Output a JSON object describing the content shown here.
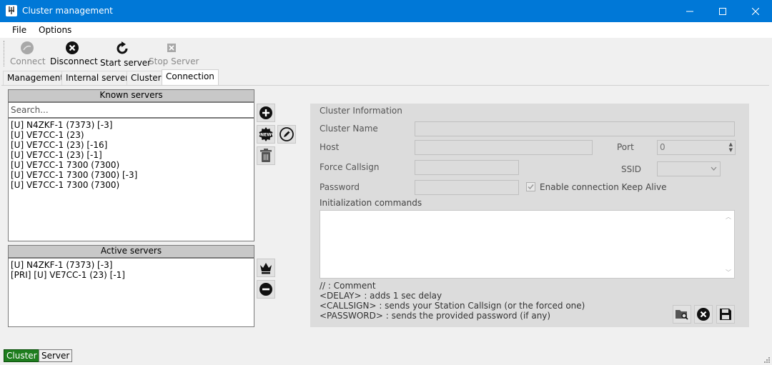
{
  "window": {
    "title": "Cluster management"
  },
  "menu": {
    "file": "File",
    "options": "Options"
  },
  "toolbar": {
    "connect": "Connect",
    "disconnect": "Disconnect",
    "start_server": "Start server",
    "stop_server": "Stop Server"
  },
  "tabs": {
    "management": "Management",
    "internal_server": "Internal server",
    "cluster": "Cluster",
    "connection": "Connection"
  },
  "known_servers": {
    "header": "Known servers",
    "search_placeholder": "Search...",
    "items": [
      "[U] N4ZKF-1 (7373) [-3]",
      "[U] VE7CC-1 (23)",
      "[U] VE7CC-1 (23) [-16]",
      "[U] VE7CC-1 (23) [-1]",
      "[U] VE7CC-1 7300 (7300)",
      "[U] VE7CC-1 7300 (7300) [-3]",
      "[U] VE7CC-1 7300 (7300)"
    ]
  },
  "active_servers": {
    "header": "Active servers",
    "items": [
      "[U] N4ZKF-1 (7373) [-3]",
      "[PRI] [U] VE7CC-1 (23) [-1]"
    ]
  },
  "cluster_info": {
    "group_title": "Cluster Information",
    "name_label": "Cluster Name",
    "host_label": "Host",
    "port_label": "Port",
    "port_value": "0",
    "force_callsign_label": "Force Callsign",
    "ssid_label": "SSID",
    "password_label": "Password",
    "keep_alive_label": "Enable connection Keep Alive",
    "keep_alive_checked": true,
    "init_commands_label": "Initialization commands",
    "help": [
      "// : Comment",
      "<DELAY> : adds 1 sec delay",
      "<CALLSIGN> : sends your Station Callsign (or the forced one)",
      "<PASSWORD> : sends the provided password (if any)"
    ]
  },
  "status": {
    "cluster": "Cluster",
    "server": "Server"
  },
  "colors": {
    "titlebar": "#0078d7",
    "status_active": "#1e7d1e"
  }
}
